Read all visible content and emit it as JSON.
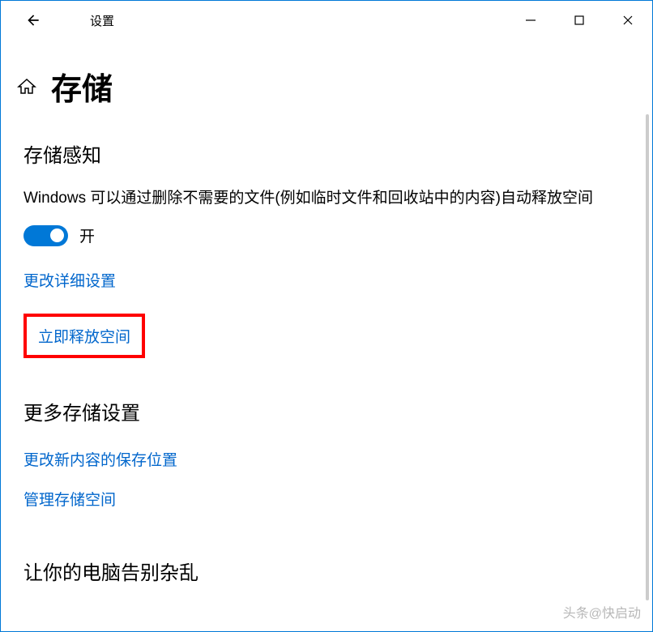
{
  "window": {
    "title": "设置"
  },
  "header": {
    "page_title": "存储"
  },
  "storage_sense": {
    "title": "存储感知",
    "description": "Windows 可以通过删除不需要的文件(例如临时文件和回收站中的内容)自动释放空间",
    "toggle_state": "开",
    "link_detail_settings": "更改详细设置",
    "link_free_now": "立即释放空间"
  },
  "more_storage": {
    "title": "更多存储设置",
    "link_change_save_location": "更改新内容的保存位置",
    "link_manage_storage": "管理存储空间"
  },
  "cleanup": {
    "title": "让你的电脑告别杂乱"
  },
  "watermark": "头条@快启动"
}
